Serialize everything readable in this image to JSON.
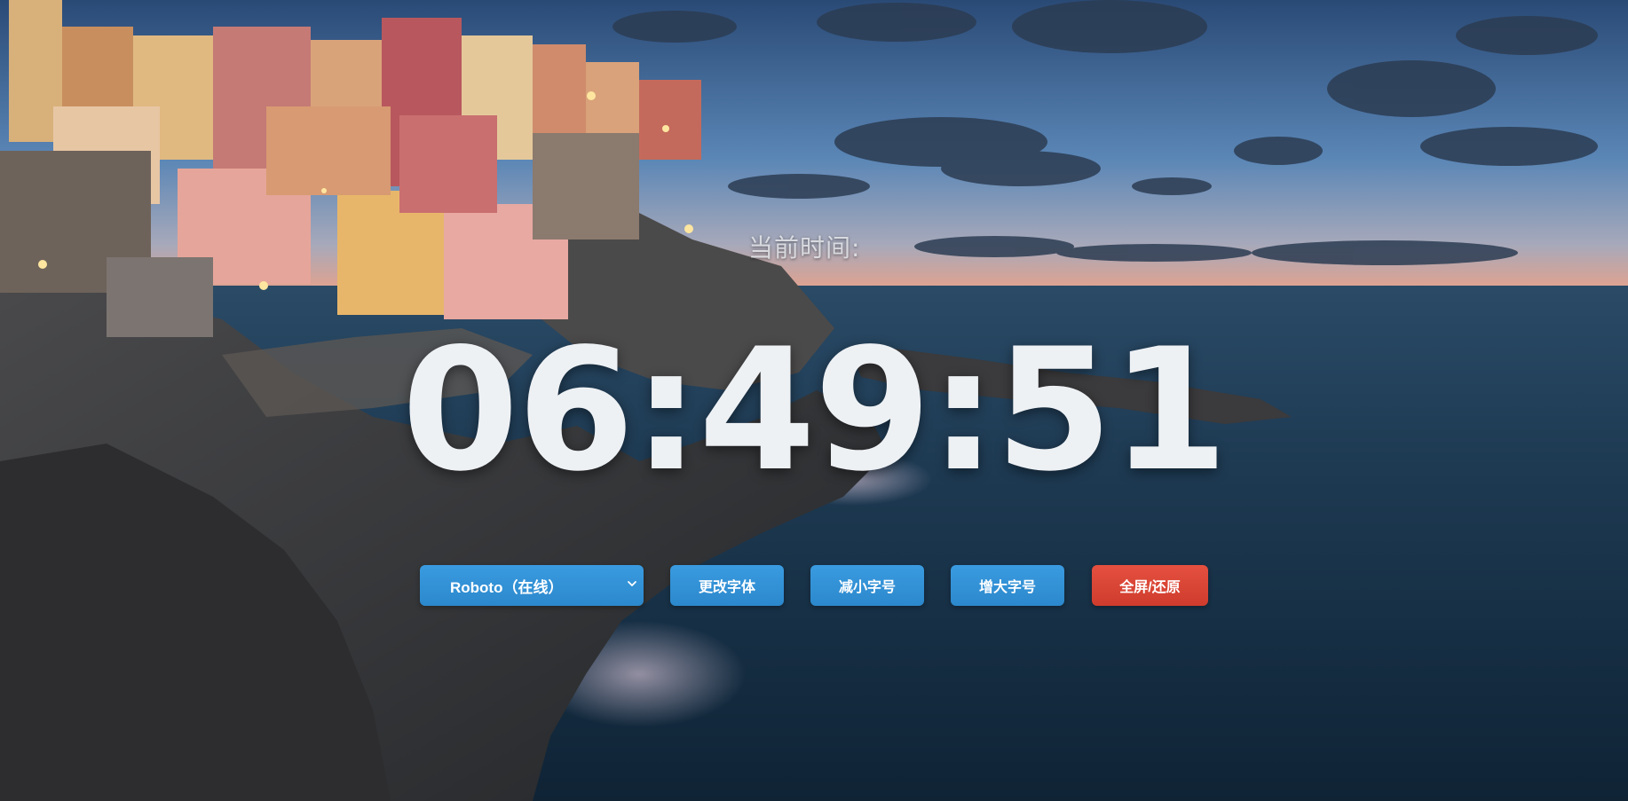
{
  "clock": {
    "label": "当前时间:",
    "time": "06:49:51"
  },
  "controls": {
    "font_select": {
      "selected": "Roboto（在线）",
      "icon": "chevron-down-icon"
    },
    "change_font_label": "更改字体",
    "decrease_size_label": "减小字号",
    "increase_size_label": "增大字号",
    "fullscreen_label": "全屏/还原"
  },
  "colors": {
    "button_blue": "#3a9be0",
    "button_red": "#e5503f",
    "clock_text": "#eef1f4"
  }
}
